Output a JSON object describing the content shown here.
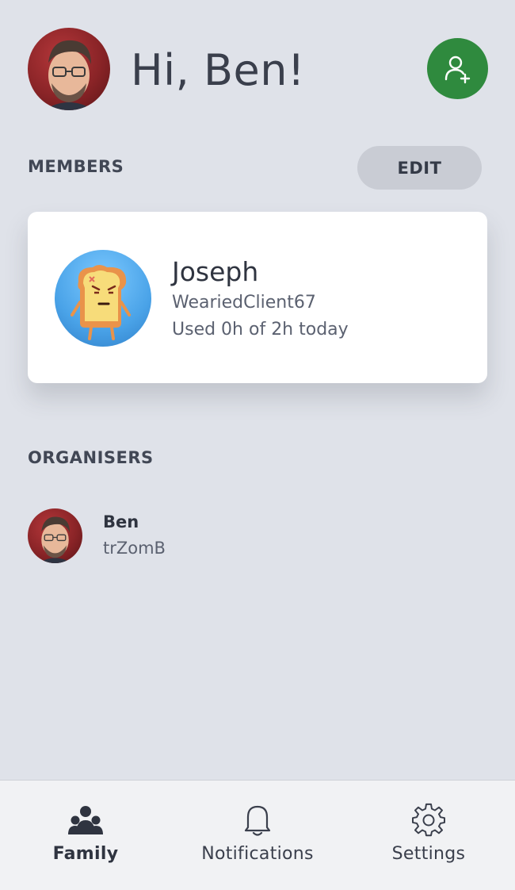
{
  "header": {
    "greeting": "Hi, Ben!",
    "add_member_icon": "add-person-icon"
  },
  "members": {
    "section_label": "MEMBERS",
    "edit_label": "EDIT",
    "items": [
      {
        "name": "Joseph",
        "gamertag": "WeariedClient67",
        "usage": "Used 0h of 2h today",
        "avatar": "toast-avatar"
      }
    ]
  },
  "organisers": {
    "section_label": "ORGANISERS",
    "items": [
      {
        "name": "Ben",
        "gamertag": "trZomB",
        "avatar": "ben-avatar"
      }
    ]
  },
  "bottom_nav": {
    "items": [
      {
        "label": "Family",
        "icon": "family-icon",
        "active": true
      },
      {
        "label": "Notifications",
        "icon": "bell-icon",
        "active": false
      },
      {
        "label": "Settings",
        "icon": "gear-icon",
        "active": false
      }
    ]
  },
  "colors": {
    "background": "#dfe2e9",
    "accent_green": "#2f8a3e",
    "card": "#ffffff",
    "nav_bg": "#f1f2f4"
  }
}
